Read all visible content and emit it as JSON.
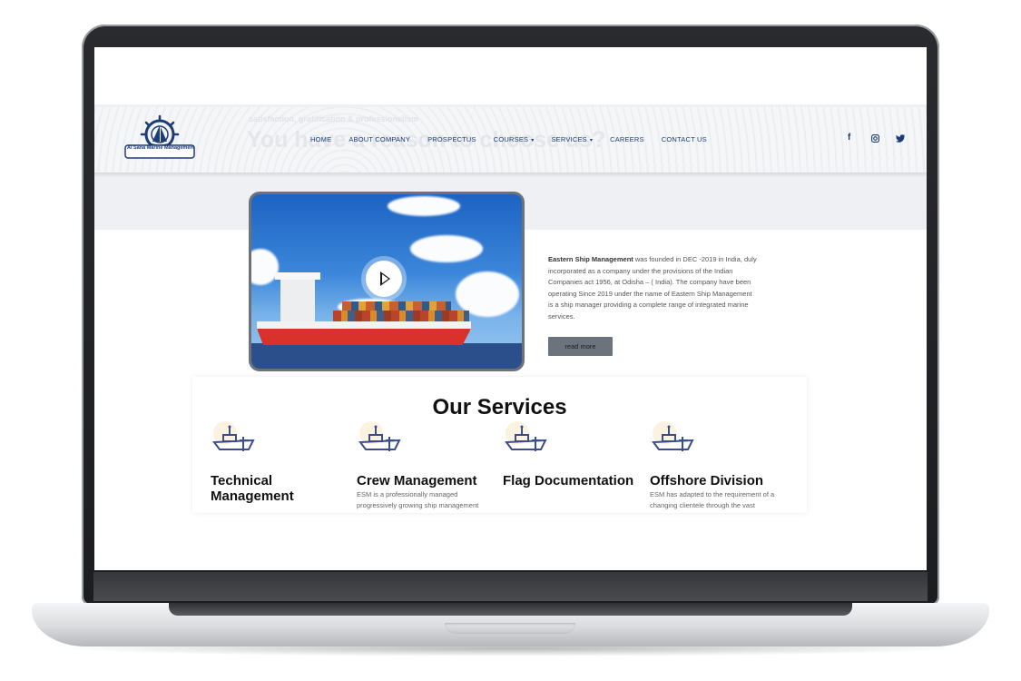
{
  "site": {
    "logo_name": "Al Sana Marine Management"
  },
  "hero": {
    "tagline": "satisfaction, gratification & professionalism",
    "heading": "You have a reason to choose us?"
  },
  "nav": {
    "items": [
      {
        "label": "HOME",
        "dropdown": false
      },
      {
        "label": "ABOUT COMPANY",
        "dropdown": false
      },
      {
        "label": "PROSPECTUS",
        "dropdown": false
      },
      {
        "label": "COURSES",
        "dropdown": true
      },
      {
        "label": "SERVICES",
        "dropdown": true
      },
      {
        "label": "CAREERS",
        "dropdown": false
      },
      {
        "label": "CONTACT US",
        "dropdown": false
      }
    ],
    "caret": "▾"
  },
  "social": {
    "facebook": "f",
    "instagram": "◎",
    "twitter": "🐦"
  },
  "about": {
    "company": "Eastern Ship Management",
    "text": " was founded in DEC -2019 in India, duly incorporated as a company under the provisions of the Indian Companies act 1956, at Odisha – ( India). The company have been operating Since 2019 under the name of Eastern Ship Management is a ship manager providing a complete range of integrated marine services.",
    "read_more": "read more"
  },
  "services": {
    "title": "Our Services",
    "items": [
      {
        "title": "Technical Management",
        "desc": ""
      },
      {
        "title": "Crew Management",
        "desc": "ESM is a professionally managed progressively growing ship management"
      },
      {
        "title": "Flag Documentation",
        "desc": ""
      },
      {
        "title": "Offshore Division",
        "desc": "ESM has adapted to the requirement of a changing clientele through the vast"
      }
    ]
  },
  "colors": {
    "brand_navy": "#1d3c78",
    "button_gray": "#6b737c"
  }
}
